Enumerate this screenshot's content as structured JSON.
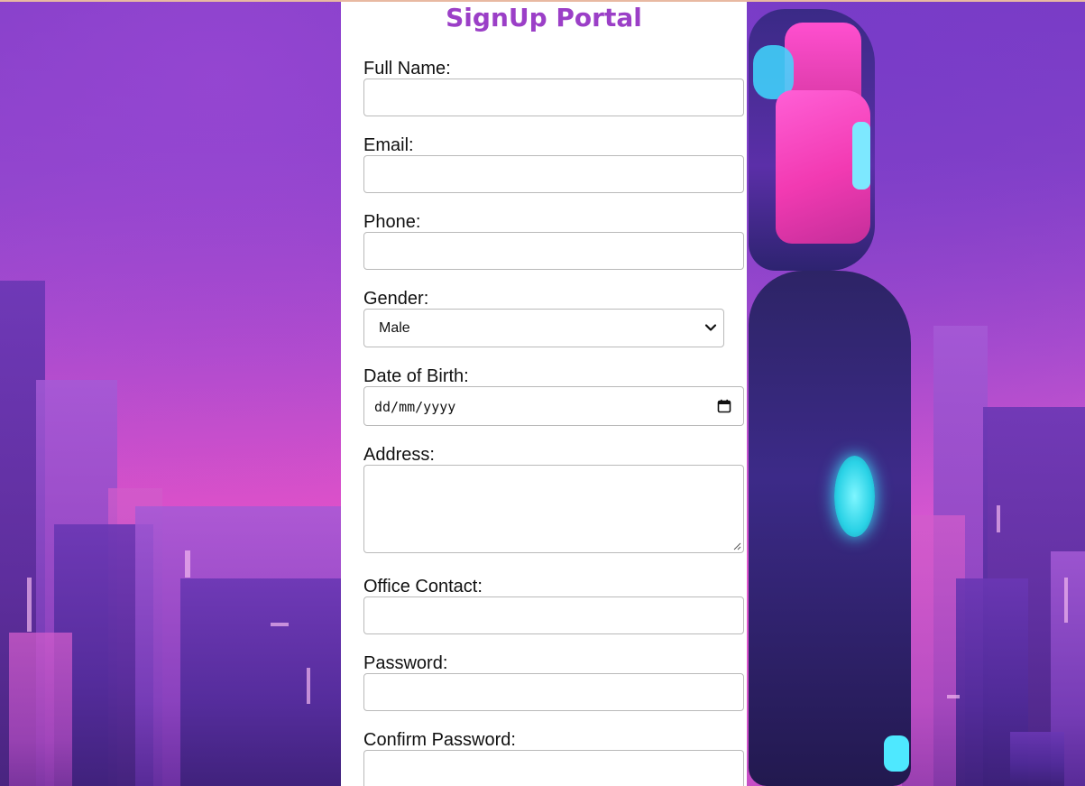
{
  "form": {
    "title": "SignUp Portal",
    "full_name": {
      "label": "Full Name:",
      "value": ""
    },
    "email": {
      "label": "Email:",
      "value": ""
    },
    "phone": {
      "label": "Phone:",
      "value": ""
    },
    "gender": {
      "label": "Gender:",
      "selected": "Male"
    },
    "dob": {
      "label": "Date of Birth:",
      "placeholder": "dd/mm/yyyy"
    },
    "address": {
      "label": "Address:",
      "value": ""
    },
    "office_contact": {
      "label": "Office Contact:",
      "value": ""
    },
    "password": {
      "label": "Password:",
      "value": ""
    },
    "confirm_password": {
      "label": "Confirm Password:",
      "value": ""
    }
  },
  "colors": {
    "title": "#9b3fc7",
    "panel_background": "#ffffff",
    "input_border": "#b9b9b9"
  },
  "icons": {
    "gender_dropdown": "chevron-down-icon",
    "dob_picker": "calendar-icon",
    "address_resize": "resize-handle-icon"
  }
}
